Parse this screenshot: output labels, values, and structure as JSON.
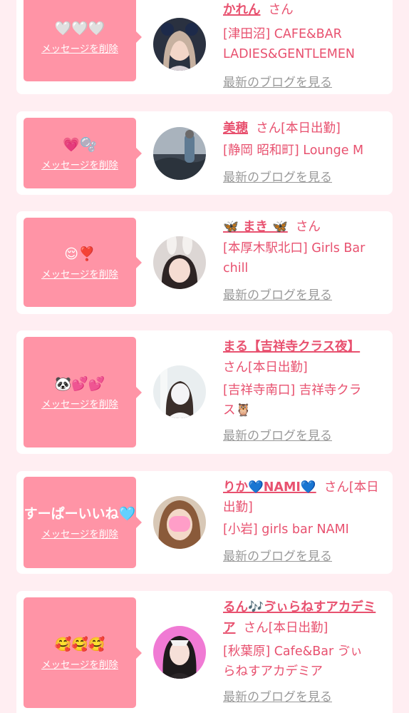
{
  "accent_color": "#ff94a6",
  "name_color": "#e8516f",
  "delete_label": "メッセージを削除",
  "blog_label": "最新のブログを見る",
  "entries": [
    {
      "message": "🤍🤍🤍",
      "name": "かれん",
      "suffix": "さん",
      "shop_line1": "[津田沼] CAFE&BAR",
      "shop_line2": "LADIES&GENTLEMEN"
    },
    {
      "message": "💗🫧",
      "name": "美穂",
      "suffix": "さん[本日出勤]",
      "shop_line1": "[静岡 昭和町] Lounge M",
      "shop_line2": ""
    },
    {
      "message": "😌❣️",
      "name": "🦋 まき 🦋",
      "suffix": "さん",
      "shop_line1": "[本厚木駅北口] Girls Bar",
      "shop_line2": "chill"
    },
    {
      "message": "🐼💕💕",
      "name": "まる【吉祥寺クラス夜】",
      "suffix": "さん[本日出勤]",
      "shop_line1": "[吉祥寺南口] 吉祥寺クラ",
      "shop_line2": "ス🦉"
    },
    {
      "message": "すーぱーいいね🩵",
      "name": "りか💙NAMI💙",
      "suffix": "さん[本日出勤]",
      "shop_line1": "[小岩] girls bar NAMI",
      "shop_line2": ""
    },
    {
      "message": "🥰🥰🥰",
      "name": "るん🎶ゔぃらねすアカデミア",
      "suffix": "さん[本日出勤]",
      "shop_line1": "[秋葉原] Cafe&Bar ゔぃ",
      "shop_line2": "らねすアカデミア"
    }
  ]
}
